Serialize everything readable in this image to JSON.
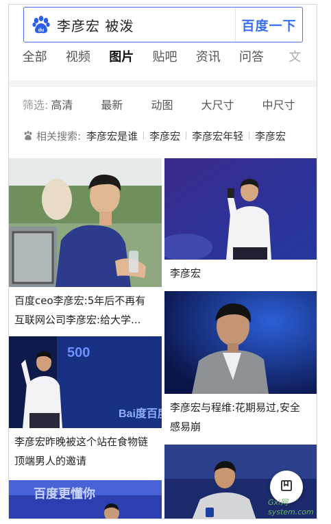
{
  "search": {
    "query": "李彦宏 被泼",
    "button_label": "百度一下",
    "logo_icon": "baidu-paw-icon"
  },
  "tabs": [
    {
      "label": "全部"
    },
    {
      "label": "视频"
    },
    {
      "label": "图片"
    },
    {
      "label": "贴吧"
    },
    {
      "label": "资讯"
    },
    {
      "label": "问答"
    },
    {
      "label": "文"
    }
  ],
  "active_tab": "图片",
  "filters": {
    "label": "筛选:",
    "items": [
      "高清",
      "最新",
      "动图",
      "大尺寸",
      "中尺寸"
    ]
  },
  "related": {
    "label": "相关搜索:",
    "items": [
      "李彦宏是谁",
      "李彦宏",
      "李彦宏年轻",
      "李彦宏"
    ]
  },
  "results": [
    {
      "caption_line1": "百度ceo李彦宏:5年后不再有",
      "caption_line2": "互联网公司李彦宏:给大学..."
    },
    {
      "caption_line1": "李彦宏",
      "caption_line2": ""
    },
    {
      "caption_line1": "李彦宏昨晚被这个站在食物链",
      "caption_line2": "顶端男人的邀请"
    },
    {
      "caption_line1": "李彦宏与程维:花期易过,安全",
      "caption_line2": "感易崩"
    },
    {
      "caption_line1": "",
      "caption_line2": ""
    },
    {
      "caption_line1": "",
      "caption_line2": ""
    }
  ],
  "image_text": {
    "stage_logo": "Bai度百度",
    "stage_banner": "百度更懂你",
    "number": "500"
  },
  "fab_icon": "bookmark-icon",
  "watermark": "Gxi网 system.com",
  "colors": {
    "accent": "#3a6ef2",
    "band": "#f2f3f5"
  }
}
